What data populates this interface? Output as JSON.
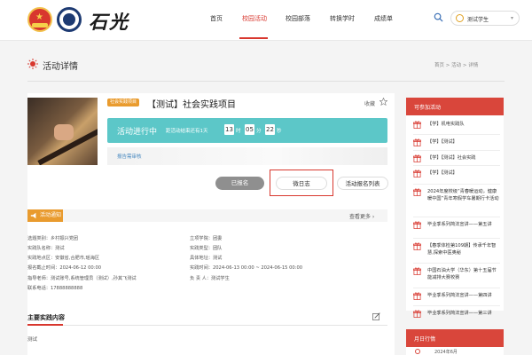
{
  "header": {
    "brand_text": "石光",
    "nav": [
      {
        "label": "首页"
      },
      {
        "label": "校园活动"
      },
      {
        "label": "校园部落"
      },
      {
        "label": "转换学时"
      },
      {
        "label": "成绩单"
      }
    ],
    "active_nav": "校园活动",
    "user_name": "测试学生"
  },
  "page": {
    "title": "活动详情",
    "breadcrumb": "首页 > 活动 > 详情"
  },
  "activity": {
    "badge": "社会实践项目",
    "title": "【测试】社会实践项目",
    "favorite_label": "收藏",
    "status_label": "活动进行中",
    "countdown_prefix": "距活动结束还有1天",
    "countdown": {
      "hours": "13",
      "minutes": "05",
      "seconds": "22"
    },
    "unit_hour": "时",
    "unit_minute": "分",
    "unit_second": "秒",
    "report_link": "报告需审核"
  },
  "actions": {
    "joined": "已报名",
    "weibo": "微日志",
    "signup_list": "活动报名列表"
  },
  "notice": {
    "tab_label": "活动通知",
    "more_label": "查看更多",
    "left": [
      "选题类别：乡村振兴党团",
      "实践队名称：测试",
      "实践地点区：安徽省,合肥市,瑶海区",
      "报名截止时间：2024-06-12 00:00",
      "指导老师：测试账号,系统管理员（测试）,孙其飞测试",
      "联系电话：17888888888"
    ],
    "right": [
      "立项学院：团委",
      "实践类型：团队",
      "具体地址：测试",
      "实践时间：2024-06-13 00:00 ~ 2024-06-15 00:00",
      "负 责 人：测试学生"
    ]
  },
  "main_content": {
    "title": "主要实践内容",
    "text": "测试"
  },
  "sidebar": {
    "title": "可参加活动",
    "items": [
      "【学】机电实践队",
      "【学】【测试】",
      "【学】【测试】社会实践",
      "【学】【测试】",
      "2024年度校级“青春暖运动，健康暖中国”青年寒假学车暑期行卡活动",
      "毕业季系列简法宣讲——第五讲",
      "【春季体检第109期】传承千年智慧,探索中医奥秘",
      "中国石油大学（华东）第十五届节能减排大赛校赛",
      "毕业季系列简法宣讲——第四讲",
      "毕业季系列简法宣讲——第三讲"
    ],
    "calendar_title": "月日行惰",
    "calendar_text": "2024年6月"
  },
  "colors": {
    "accent": "#d8372e",
    "teal": "#5cc7c8",
    "orange": "#e99b2e"
  }
}
